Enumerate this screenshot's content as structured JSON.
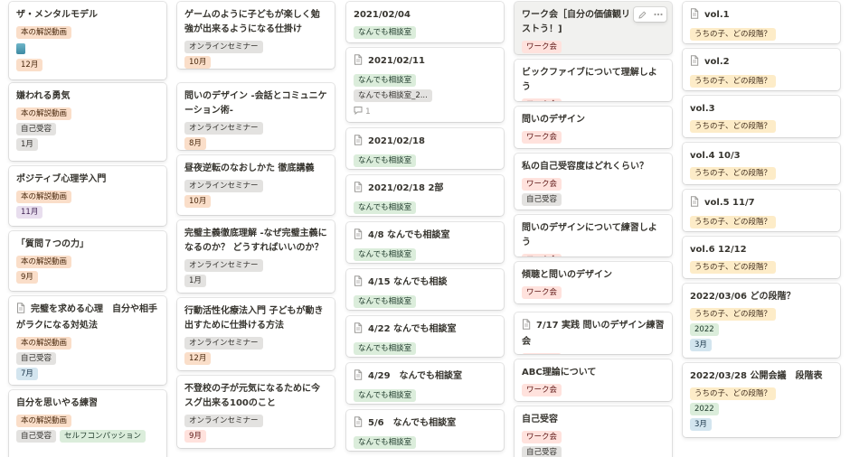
{
  "colors": {
    "tag_orange": "#fadec9",
    "tag_orange_text": "#49290e",
    "tag_gray": "#e3e2e0",
    "tag_gray_text": "#32302c",
    "tag_yellow": "#fdecc8",
    "tag_yellow_text": "#402c1b",
    "tag_purple": "#e8deee",
    "tag_purple_text": "#412454",
    "tag_red": "#ffe2dd",
    "tag_red_text": "#5d1715",
    "tag_blue": "#d3e5ef",
    "tag_blue_text": "#183347",
    "tag_green": "#dbeddb",
    "tag_green_text": "#1c3829",
    "tag_brown": "#eee0da"
  },
  "columns": [
    {
      "cards": [
        {
          "title": "ザ・メンタルモデル",
          "doc": false,
          "tags": [
            [
              "本の解説動画",
              "orange"
            ]
          ],
          "has_image_icon": true,
          "month": [
            "12月",
            "orange"
          ]
        },
        {
          "title": "嫌われる勇気",
          "doc": false,
          "tags": [
            [
              "本の解説動画",
              "orange"
            ]
          ],
          "tags2": [
            [
              "自己受容",
              "gray"
            ]
          ],
          "month": [
            "1月",
            "gray"
          ]
        },
        {
          "title": "ポジティブ心理学入門",
          "doc": false,
          "tags": [
            [
              "本の解説動画",
              "orange"
            ]
          ],
          "month": [
            "11月",
            "purple"
          ]
        },
        {
          "title": "「質問７つの力」",
          "doc": false,
          "tags": [
            [
              "本の解説動画",
              "orange"
            ]
          ],
          "month": [
            "9月",
            "orange"
          ]
        },
        {
          "title": "完璧を求める心理　自分や相手がラクになる対処法",
          "doc": true,
          "tags": [
            [
              "本の解説動画",
              "orange"
            ]
          ],
          "tags2": [
            [
              "自己受容",
              "gray"
            ]
          ],
          "month": [
            "7月",
            "blue"
          ]
        },
        {
          "title": "自分を思いやる練習",
          "doc": false,
          "tags": [
            [
              "本の解説動画",
              "orange"
            ]
          ],
          "tags2": [
            [
              "自己受容",
              "gray"
            ],
            [
              "セルフコンパッション",
              "green"
            ]
          ]
        }
      ]
    },
    {
      "cards": [
        {
          "title": "ゲームのように子どもが楽しく勉強が出来るようになる仕掛け",
          "tags": [
            [
              "オンラインセミナー",
              "gray"
            ]
          ],
          "month": [
            "10月",
            "orange"
          ]
        },
        {
          "title": "問いのデザイン -会話とコミュニケーション術-",
          "tags": [
            [
              "オンラインセミナー",
              "gray"
            ]
          ],
          "month": [
            "8月",
            "orange"
          ]
        },
        {
          "title": "昼夜逆転のなおしかた 徹底講義",
          "tags": [
            [
              "オンラインセミナー",
              "gray"
            ]
          ],
          "month": [
            "10月",
            "orange"
          ]
        },
        {
          "title": "完璧主義徹底理解 -なぜ完璧主義になるのか？ どうすればいいのか？",
          "tags": [
            [
              "オンラインセミナー",
              "gray"
            ]
          ],
          "month": [
            "1月",
            "gray"
          ]
        },
        {
          "title": "行動活性化療法入門 子どもが動き出すために仕掛ける方法",
          "tags": [
            [
              "オンラインセミナー",
              "gray"
            ]
          ],
          "month": [
            "12月",
            "orange"
          ]
        },
        {
          "title": "不登校の子が元気になるために今スグ出来る100のこと",
          "tags": [
            [
              "オンラインセミナー",
              "gray"
            ]
          ],
          "month": [
            "9月",
            "red"
          ]
        }
      ]
    },
    {
      "cards": [
        {
          "title": "2021/02/04",
          "doc": false,
          "tags": [
            [
              "なんでも相談室",
              "green"
            ]
          ]
        },
        {
          "title": "2021/02/11",
          "doc": true,
          "tags": [
            [
              "なんでも相談室",
              "green"
            ]
          ],
          "tags2": [
            [
              "なんでも相談室_2...",
              "gray"
            ]
          ],
          "comments": "1"
        },
        {
          "title": "2021/02/18",
          "doc": true,
          "tags": [
            [
              "なんでも相談室",
              "green"
            ]
          ]
        },
        {
          "title": "2021/02/18 2部",
          "doc": true,
          "tags": [
            [
              "なんでも相談室",
              "green"
            ]
          ]
        },
        {
          "title": "4/8 なんでも相談室",
          "doc": true,
          "tags": [
            [
              "なんでも相談室",
              "green"
            ]
          ]
        },
        {
          "title": "4/15 なんでも相談",
          "doc": true,
          "tags": [
            [
              "なんでも相談室",
              "green"
            ]
          ]
        },
        {
          "title": "4/22 なんでも相談室",
          "doc": true,
          "tags": [
            [
              "なんでも相談室",
              "green"
            ]
          ]
        },
        {
          "title": "4/29　なんでも相談室",
          "doc": true,
          "tags": [
            [
              "なんでも相談室",
              "green"
            ]
          ]
        },
        {
          "title": "5/6　なんでも相談室",
          "doc": true,
          "tags": [
            [
              "なんでも相談室",
              "green"
            ]
          ]
        }
      ]
    },
    {
      "cards": [
        {
          "title": "ワーク会［自分の価値観リストう！]",
          "doc": false,
          "tags": [
            [
              "ワーク会",
              "red"
            ]
          ],
          "hover": true
        },
        {
          "title": "ビックファイブについて理解しよう",
          "tags": [
            [
              "ワーク会",
              "red"
            ]
          ]
        },
        {
          "title": "問いのデザイン",
          "tags": [
            [
              "ワーク会",
              "red"
            ]
          ]
        },
        {
          "title": "私の自己受容度はどれくらい？",
          "tags": [
            [
              "ワーク会",
              "red"
            ]
          ],
          "tags2": [
            [
              "自己受容",
              "gray"
            ]
          ]
        },
        {
          "title": "問いのデザインについて練習しよう",
          "tags": [
            [
              "ワーク会",
              "red"
            ]
          ]
        },
        {
          "title": "傾聴と問いのデザイン",
          "tags": [
            [
              "ワーク会",
              "red"
            ]
          ]
        },
        {
          "title": "7/17 実践 問いのデザイン練習会",
          "doc": true,
          "tags": [
            [
              "ワーク会",
              "red"
            ]
          ]
        },
        {
          "title": "ABC理論について",
          "tags": [
            [
              "ワーク会",
              "red"
            ]
          ]
        },
        {
          "title": "自己受容",
          "tags": [
            [
              "ワーク会",
              "red"
            ]
          ],
          "tags2": [
            [
              "自己受容",
              "gray"
            ]
          ]
        }
      ]
    },
    {
      "cards": [
        {
          "title": "vol.1",
          "doc": true,
          "tags": [
            [
              "うちの子、どの段階？",
              "yellow"
            ]
          ]
        },
        {
          "title": "vol.2",
          "doc": true,
          "tags": [
            [
              "うちの子、どの段階？",
              "yellow"
            ]
          ]
        },
        {
          "title": "vol.3",
          "tags": [
            [
              "うちの子、どの段階？",
              "yellow"
            ]
          ]
        },
        {
          "title": "vol.4 10/3",
          "tags": [
            [
              "うちの子、どの段階？",
              "yellow"
            ]
          ]
        },
        {
          "title": "vol.5 11/7",
          "doc": true,
          "tags": [
            [
              "うちの子、どの段階？",
              "yellow"
            ]
          ]
        },
        {
          "title": "vol.6 12/12",
          "tags": [
            [
              "うちの子、どの段階？",
              "yellow"
            ]
          ]
        },
        {
          "title": "2022/03/06 どの段階？",
          "tags": [
            [
              "うちの子、どの段階？",
              "yellow"
            ]
          ],
          "tags2": [
            [
              "2022",
              "green"
            ]
          ],
          "month": [
            "3月",
            "blue"
          ]
        },
        {
          "title": "2022/03/28 公開会議　段階表",
          "tags": [
            [
              "うちの子、どの段階？",
              "yellow"
            ]
          ],
          "tags2": [
            [
              "2022",
              "green"
            ]
          ],
          "month": [
            "3月",
            "blue"
          ]
        }
      ]
    }
  ],
  "icons": {
    "doc": "document-icon",
    "comment": "comment-icon",
    "edit": "pencil-icon",
    "more": "more-icon"
  }
}
